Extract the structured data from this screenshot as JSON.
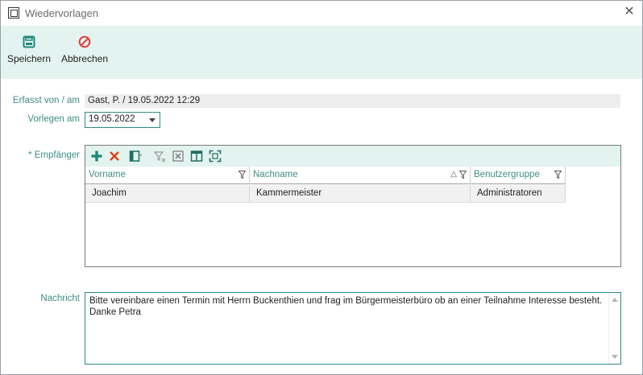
{
  "window": {
    "title": "Wiedervorlagen"
  },
  "toolbar": {
    "save_label": "Speichern",
    "cancel_label": "Abbrechen"
  },
  "form": {
    "erfasst_label": "Erfasst von / am",
    "erfasst_value": "Gast, P. / 19.05.2022 12:29",
    "vorlegen_label": "Vorlegen am",
    "vorlegen_value": "19.05.2022",
    "empfaenger_label": "* Empfänger",
    "nachricht_label": "Nachricht",
    "nachricht_value": "Bitte vereinbare einen Termin mit Herrn Buckenthien und frag im Bürgermeisterbüro ob an einer Teilnahme Interesse besteht.  Danke Petra"
  },
  "grid": {
    "columns": [
      "Vorname",
      "Nachname",
      "Benutzergruppe"
    ],
    "rows": [
      [
        "Joachim",
        "Kammermeister",
        "Administratoren"
      ]
    ]
  },
  "colors": {
    "accent": "#2e8b7f",
    "toolbar_bg": "#e3f3ef",
    "label": "#3e8e86"
  }
}
